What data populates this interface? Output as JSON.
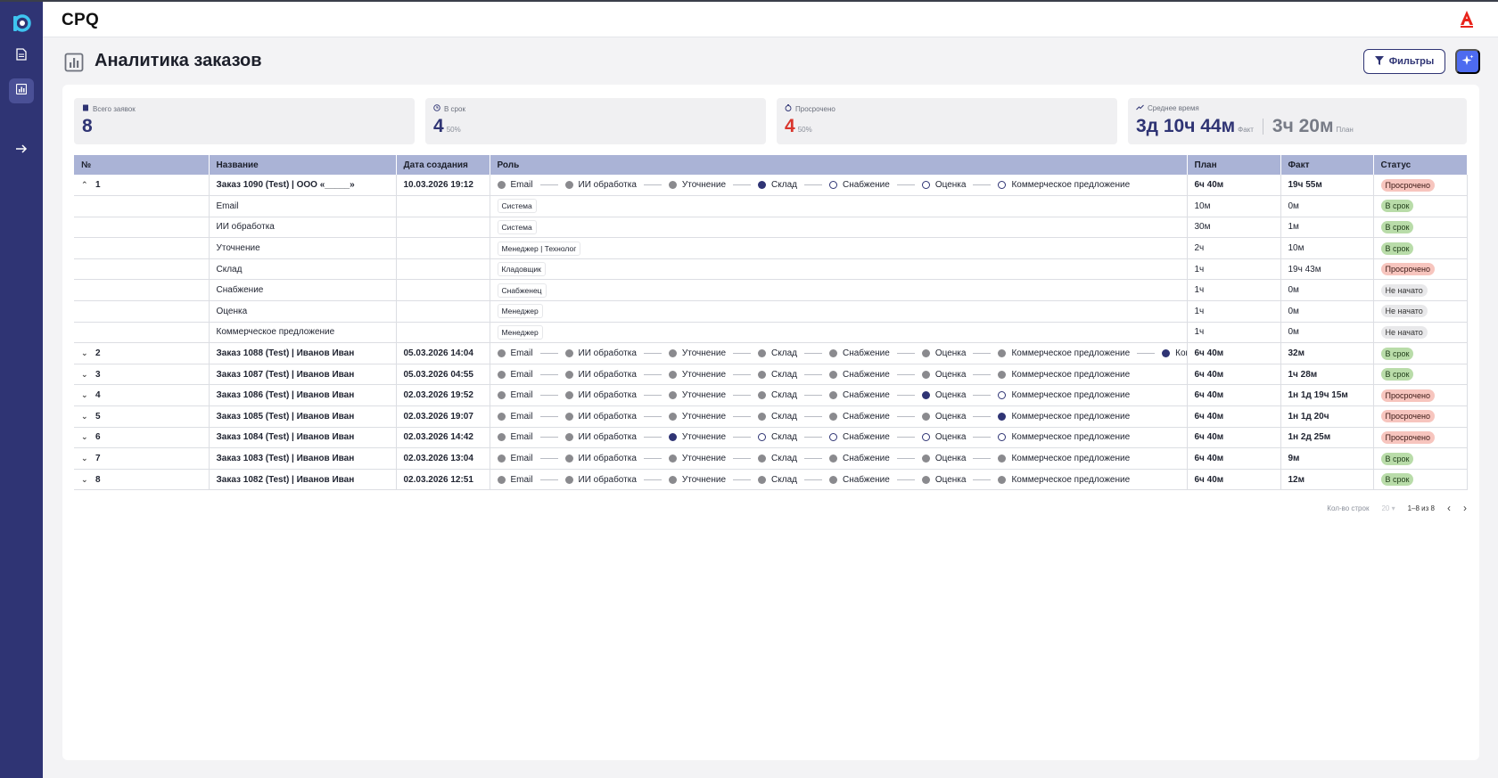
{
  "app": {
    "title": "CPQ"
  },
  "page": {
    "title": "Аналитика заказов",
    "filters_label": "Фильтры"
  },
  "kpis": {
    "total": {
      "label": "Всего заявок",
      "value": "8"
    },
    "ontime": {
      "label": "В срок",
      "value": "4",
      "pct": "50%"
    },
    "overdue": {
      "label": "Просрочено",
      "value": "4",
      "pct": "50%"
    },
    "avg": {
      "label": "Среднее время",
      "fact": "3д 10ч 44м",
      "fact_label": "Факт",
      "plan": "3ч 20м",
      "plan_label": "План"
    }
  },
  "table": {
    "headers": [
      "№",
      "Название",
      "Дата создания",
      "Роль",
      "План",
      "Факт",
      "Статус"
    ],
    "expanded": {
      "num": "1",
      "name": "Заказ 1090 (Test) | ООО «_____»",
      "date": "10.03.2026 19:12",
      "plan": "6ч 40м",
      "fact": "19ч 55м",
      "status": "Просрочено",
      "steps": [
        {
          "label": "Email",
          "state": "done"
        },
        {
          "label": "ИИ обработка",
          "state": "done"
        },
        {
          "label": "Уточнение",
          "state": "done"
        },
        {
          "label": "Склад",
          "state": "cur"
        },
        {
          "label": "Снабжение",
          "state": "todo"
        },
        {
          "label": "Оценка",
          "state": "todo"
        },
        {
          "label": "Коммерческое предложение",
          "state": "todo"
        }
      ],
      "subrows": [
        {
          "name": "Email",
          "role": "Система",
          "plan": "10м",
          "fact": "0м",
          "status": "В срок",
          "kind": "ok"
        },
        {
          "name": "ИИ обработка",
          "role": "Система",
          "plan": "30м",
          "fact": "1м",
          "status": "В срок",
          "kind": "ok"
        },
        {
          "name": "Уточнение",
          "role": "Менеджер | Технолог",
          "plan": "2ч",
          "fact": "10м",
          "status": "В срок",
          "kind": "ok"
        },
        {
          "name": "Склад",
          "role": "Кладовщик",
          "plan": "1ч",
          "fact": "19ч 43м",
          "status": "Просрочено",
          "kind": "late"
        },
        {
          "name": "Снабжение",
          "role": "Снабженец",
          "plan": "1ч",
          "fact": "0м",
          "status": "Не начато",
          "kind": "ns"
        },
        {
          "name": "Оценка",
          "role": "Менеджер",
          "plan": "1ч",
          "fact": "0м",
          "status": "Не начато",
          "kind": "ns"
        },
        {
          "name": "Коммерческое предложение",
          "role": "Менеджер",
          "plan": "1ч",
          "fact": "0м",
          "status": "Не начато",
          "kind": "ns"
        }
      ]
    },
    "rows": [
      {
        "num": "2",
        "name": "Заказ 1088 (Test) | Иванов Иван",
        "date": "05.03.2026 14:04",
        "plan": "6ч 40м",
        "fact": "32м",
        "status": "В срок",
        "kind": "ok",
        "steps": [
          {
            "label": "Email",
            "state": "done"
          },
          {
            "label": "ИИ обработка",
            "state": "done"
          },
          {
            "label": "Уточнение",
            "state": "done"
          },
          {
            "label": "Склад",
            "state": "done"
          },
          {
            "label": "Снабжение",
            "state": "done"
          },
          {
            "label": "Оценка",
            "state": "done"
          },
          {
            "label": "Коммерческое предложение",
            "state": "done"
          },
          {
            "label": "Ком",
            "state": "cur"
          }
        ]
      },
      {
        "num": "3",
        "name": "Заказ 1087 (Test) | Иванов Иван",
        "date": "05.03.2026 04:55",
        "plan": "6ч 40м",
        "fact": "1ч 28м",
        "status": "В срок",
        "kind": "ok",
        "steps": [
          {
            "label": "Email",
            "state": "done"
          },
          {
            "label": "ИИ обработка",
            "state": "done"
          },
          {
            "label": "Уточнение",
            "state": "done"
          },
          {
            "label": "Склад",
            "state": "done"
          },
          {
            "label": "Снабжение",
            "state": "done"
          },
          {
            "label": "Оценка",
            "state": "done"
          },
          {
            "label": "Коммерческое предложение",
            "state": "done"
          }
        ]
      },
      {
        "num": "4",
        "name": "Заказ 1086 (Test) | Иванов Иван",
        "date": "02.03.2026 19:52",
        "plan": "6ч 40м",
        "fact": "1н 1д 19ч 15м",
        "status": "Просрочено",
        "kind": "late",
        "steps": [
          {
            "label": "Email",
            "state": "done"
          },
          {
            "label": "ИИ обработка",
            "state": "done"
          },
          {
            "label": "Уточнение",
            "state": "done"
          },
          {
            "label": "Склад",
            "state": "done"
          },
          {
            "label": "Снабжение",
            "state": "done"
          },
          {
            "label": "Оценка",
            "state": "cur"
          },
          {
            "label": "Коммерческое предложение",
            "state": "todo"
          }
        ]
      },
      {
        "num": "5",
        "name": "Заказ 1085 (Test) | Иванов Иван",
        "date": "02.03.2026 19:07",
        "plan": "6ч 40м",
        "fact": "1н 1д 20ч",
        "status": "Просрочено",
        "kind": "late",
        "steps": [
          {
            "label": "Email",
            "state": "done"
          },
          {
            "label": "ИИ обработка",
            "state": "done"
          },
          {
            "label": "Уточнение",
            "state": "done"
          },
          {
            "label": "Склад",
            "state": "done"
          },
          {
            "label": "Снабжение",
            "state": "done"
          },
          {
            "label": "Оценка",
            "state": "done"
          },
          {
            "label": "Коммерческое предложение",
            "state": "cur"
          }
        ]
      },
      {
        "num": "6",
        "name": "Заказ 1084 (Test) | Иванов Иван",
        "date": "02.03.2026 14:42",
        "plan": "6ч 40м",
        "fact": "1н 2д 25м",
        "status": "Просрочено",
        "kind": "late",
        "steps": [
          {
            "label": "Email",
            "state": "done"
          },
          {
            "label": "ИИ обработка",
            "state": "done"
          },
          {
            "label": "Уточнение",
            "state": "cur"
          },
          {
            "label": "Склад",
            "state": "todo"
          },
          {
            "label": "Снабжение",
            "state": "todo"
          },
          {
            "label": "Оценка",
            "state": "todo"
          },
          {
            "label": "Коммерческое предложение",
            "state": "todo"
          }
        ]
      },
      {
        "num": "7",
        "name": "Заказ 1083 (Test) | Иванов Иван",
        "date": "02.03.2026 13:04",
        "plan": "6ч 40м",
        "fact": "9м",
        "status": "В срок",
        "kind": "ok",
        "steps": [
          {
            "label": "Email",
            "state": "done"
          },
          {
            "label": "ИИ обработка",
            "state": "done"
          },
          {
            "label": "Уточнение",
            "state": "done"
          },
          {
            "label": "Склад",
            "state": "done"
          },
          {
            "label": "Снабжение",
            "state": "done"
          },
          {
            "label": "Оценка",
            "state": "done"
          },
          {
            "label": "Коммерческое предложение",
            "state": "done"
          }
        ]
      },
      {
        "num": "8",
        "name": "Заказ 1082 (Test) | Иванов Иван",
        "date": "02.03.2026 12:51",
        "plan": "6ч 40м",
        "fact": "12м",
        "status": "В срок",
        "kind": "ok",
        "steps": [
          {
            "label": "Email",
            "state": "done"
          },
          {
            "label": "ИИ обработка",
            "state": "done"
          },
          {
            "label": "Уточнение",
            "state": "done"
          },
          {
            "label": "Склад",
            "state": "done"
          },
          {
            "label": "Снабжение",
            "state": "done"
          },
          {
            "label": "Оценка",
            "state": "done"
          },
          {
            "label": "Коммерческое предложение",
            "state": "done"
          }
        ]
      }
    ]
  },
  "pagination": {
    "rows_label": "Кол-во строк",
    "page_size": "20",
    "range": "1–8 из 8"
  },
  "colors": {
    "primary": "#2f3474",
    "accent": "#4d6bf0",
    "late": "#f7c5be",
    "ok": "#b9dca9",
    "header": "#aab3d6"
  }
}
